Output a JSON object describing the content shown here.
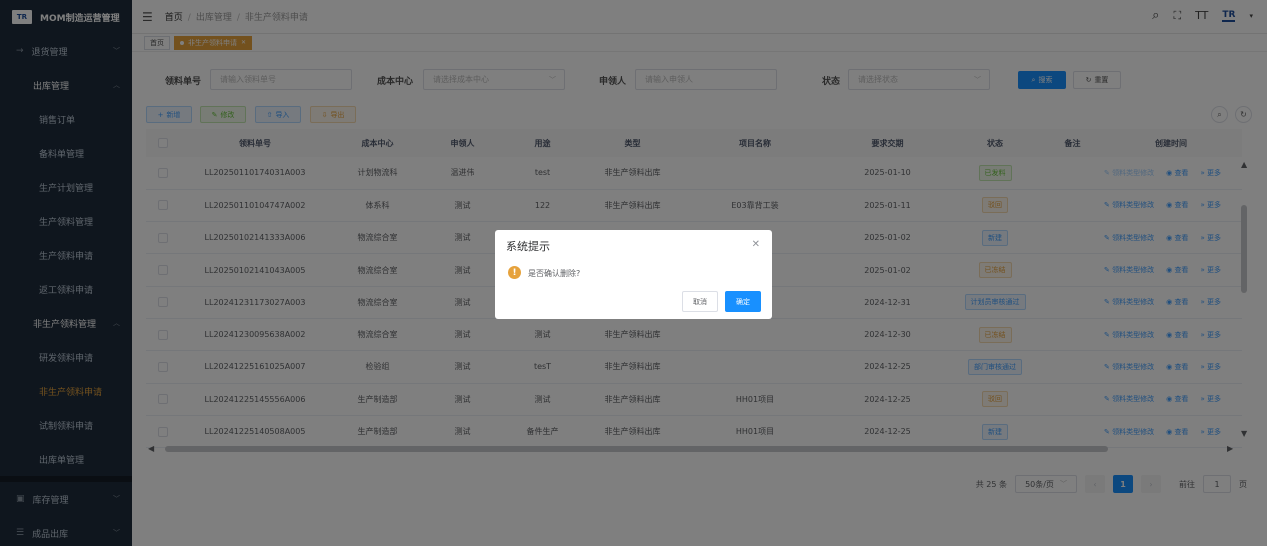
{
  "app": {
    "logo_text": "TR",
    "title": "MOM制造运营管理"
  },
  "sidebar": {
    "items": [
      {
        "label": "退货管理",
        "level": 1,
        "icon": "→"
      },
      {
        "label": "出库管理",
        "level": 2
      },
      {
        "label": "销售订单",
        "level": 3
      },
      {
        "label": "备料单管理",
        "level": 3
      },
      {
        "label": "生产计划管理",
        "level": 3
      },
      {
        "label": "生产领料管理",
        "level": 3
      },
      {
        "label": "生产领料申请",
        "level": 3
      },
      {
        "label": "返工领料申请",
        "level": 3
      },
      {
        "label": "非生产领料管理",
        "level": 2
      },
      {
        "label": "研发领料申请",
        "level": 3
      },
      {
        "label": "非生产领料申请",
        "level": 3
      },
      {
        "label": "试制领料申请",
        "level": 3
      },
      {
        "label": "出库单管理",
        "level": 3
      }
    ],
    "bottom_items": [
      {
        "label": "库存管理",
        "icon": "▣"
      },
      {
        "label": "成品出库",
        "icon": "☰"
      }
    ]
  },
  "header": {
    "breadcrumb": [
      "首页",
      "出库管理",
      "非生产领料申请"
    ],
    "brand_mini": "TR"
  },
  "tags": {
    "home": "首页",
    "current": "非生产领料申请"
  },
  "search": {
    "code_label": "领料单号",
    "code_placeholder": "请输入领料单号",
    "cost_label": "成本中心",
    "cost_placeholder": "请选择成本中心",
    "applicant_label": "申领人",
    "applicant_placeholder": "请输入申领人",
    "status_label": "状态",
    "status_placeholder": "请选择状态",
    "search_btn": "搜索",
    "reset_btn": "重置"
  },
  "toolbar": {
    "add": "新增",
    "edit": "修改",
    "import": "导入",
    "export": "导出"
  },
  "table": {
    "columns": [
      "领料单号",
      "成本中心",
      "申领人",
      "用途",
      "类型",
      "项目名称",
      "要求交期",
      "状态",
      "备注",
      "创建时间"
    ],
    "rows": [
      {
        "code": "LL20250110174031A003",
        "cost": "计划物流科",
        "applicant": "温进伟",
        "purpose": "test",
        "type": "非生产领料出库",
        "project": "",
        "due": "2025-01-10",
        "status": "已发料",
        "status_color": "green",
        "edit_disabled": true
      },
      {
        "code": "LL20250110104747A002",
        "cost": "体系科",
        "applicant": "测试",
        "purpose": "122",
        "type": "非生产领料出库",
        "project": "E03靠背工装",
        "due": "2025-01-11",
        "status": "驳回",
        "status_color": "orange",
        "edit_disabled": false
      },
      {
        "code": "LL20250102141333A006",
        "cost": "物流综合室",
        "applicant": "测试",
        "purpose": "",
        "type": "",
        "project": "",
        "due": "2025-01-02",
        "status": "新建",
        "status_color": "blue",
        "edit_disabled": false
      },
      {
        "code": "LL20250102141043A005",
        "cost": "物流综合室",
        "applicant": "测试",
        "purpose": "",
        "type": "",
        "project": "",
        "due": "2025-01-02",
        "status": "已冻结",
        "status_color": "orange",
        "edit_disabled": false
      },
      {
        "code": "LL20241231173027A003",
        "cost": "物流综合室",
        "applicant": "测试",
        "purpose": "",
        "type": "",
        "project": "",
        "due": "2024-12-31",
        "status": "计划员审核通过",
        "status_color": "blue",
        "edit_disabled": false
      },
      {
        "code": "LL20241230095638A002",
        "cost": "物流综合室",
        "applicant": "测试",
        "purpose": "测试",
        "type": "非生产领料出库",
        "project": "",
        "due": "2024-12-30",
        "status": "已冻结",
        "status_color": "orange",
        "edit_disabled": false
      },
      {
        "code": "LL20241225161025A007",
        "cost": "检验组",
        "applicant": "测试",
        "purpose": "tesT",
        "type": "非生产领料出库",
        "project": "",
        "due": "2024-12-25",
        "status": "部门审核通过",
        "status_color": "blue",
        "edit_disabled": false
      },
      {
        "code": "LL20241225145556A006",
        "cost": "生产制造部",
        "applicant": "测试",
        "purpose": "测试",
        "type": "非生产领料出库",
        "project": "HH01项目",
        "due": "2024-12-25",
        "status": "驳回",
        "status_color": "orange",
        "edit_disabled": false
      },
      {
        "code": "LL20241225140508A005",
        "cost": "生产制造部",
        "applicant": "测试",
        "purpose": "备件生产",
        "type": "非生产领料出库",
        "project": "HH01项目",
        "due": "2024-12-25",
        "status": "新建",
        "status_color": "blue",
        "edit_disabled": false
      }
    ],
    "ops": {
      "edit_type": "领料类型修改",
      "view": "查看",
      "more": "更多"
    }
  },
  "pager": {
    "total": "共 25 条",
    "page_size": "50条/页",
    "current": "1",
    "goto_label": "前往",
    "goto_value": "1",
    "page_suffix": "页"
  },
  "dialog": {
    "title": "系统提示",
    "message": "是否确认删除?",
    "cancel": "取消",
    "confirm": "确定"
  },
  "colors": {
    "accent": "#1890ff",
    "sidebar_bg": "#1f2d3d",
    "active_menu": "#e6a23c",
    "warning": "#e6a23c"
  }
}
